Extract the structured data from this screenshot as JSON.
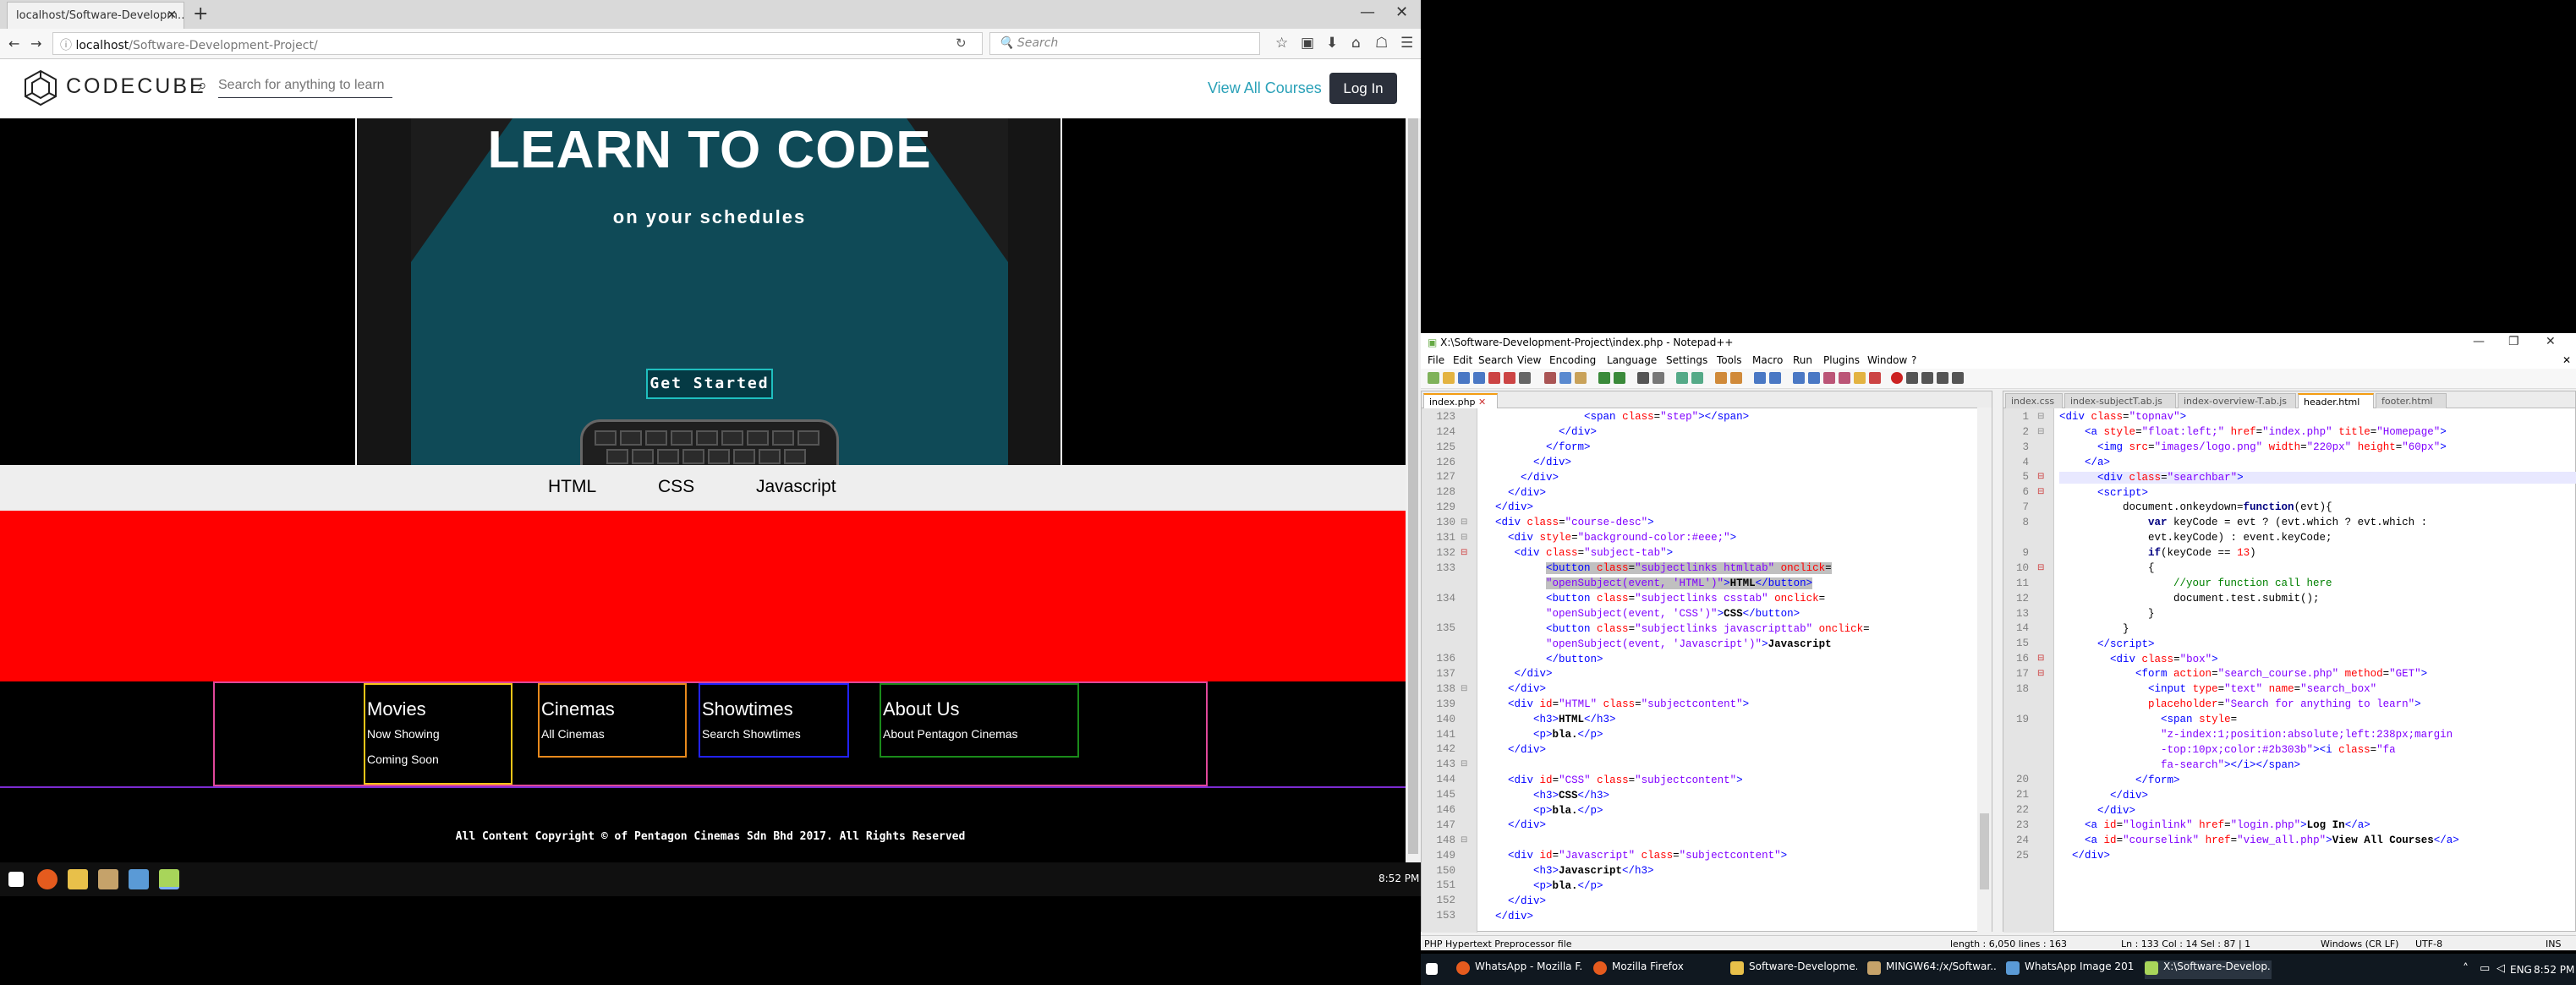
{
  "firefox": {
    "tab_title": "localhost/Software-Developm…",
    "url_host": "localhost",
    "url_path": "/Software-Development-Project/",
    "search_placeholder": "Search"
  },
  "site": {
    "logo_text": "CODECUBE",
    "search_placeholder": "Search for anything to learn",
    "view_all_courses": "View All Courses",
    "log_in": "Log In",
    "hero_title": "LEARN TO CODE",
    "hero_subtitle": "on your schedules",
    "get_started": "Get Started",
    "subjects": [
      "HTML",
      "CSS",
      "Javascript"
    ],
    "footer": [
      {
        "heading": "Movies",
        "items": [
          "Now Showing",
          "Coming Soon"
        ],
        "color": "#f5c518"
      },
      {
        "heading": "Cinemas",
        "items": [
          "All Cinemas"
        ],
        "color": "#e8891c"
      },
      {
        "heading": "Showtimes",
        "items": [
          "Search Showtimes"
        ],
        "color": "#2222ff"
      },
      {
        "heading": "About Us",
        "items": [
          "About Pentagon Cinemas"
        ],
        "color": "#1a8a1a"
      }
    ],
    "copyright": "All Content Copyright © of Pentagon Cinemas Sdn Bhd 2017. All Rights Reserved"
  },
  "left_clock": "8:52 PM",
  "npp": {
    "title": "X:\\Software-Development-Project\\index.php - Notepad++",
    "menu": [
      "File",
      "Edit",
      "Search",
      "View",
      "Encoding",
      "Language",
      "Settings",
      "Tools",
      "Macro",
      "Run",
      "Plugins",
      "Window",
      "?"
    ],
    "left_tabs": [
      "index.php"
    ],
    "right_tabs": [
      "index.css",
      "index-subjectT.ab.js",
      "index-overview-T.ab.js",
      "header.html",
      "footer.html"
    ],
    "status": {
      "type": "PHP Hypertext Preprocessor file",
      "length": "length : 6,050    lines : 163",
      "pos": "Ln : 133    Col : 14    Sel : 87 | 1",
      "eol": "Windows (CR LF)",
      "enc": "UTF-8",
      "ins": "INS"
    }
  },
  "taskbar_right": {
    "items": [
      "WhatsApp - Mozilla F...",
      "Mozilla Firefox",
      "Software-Developme...",
      "MINGW64:/x/Softwar...",
      "WhatsApp Image 201...",
      "X:\\Software-Develop..."
    ],
    "lang": "ENG",
    "clock": "8:52 PM"
  },
  "colors": {
    "brand": "#2b303b",
    "accent": "#2aa1b8",
    "hero": "#0f4a57"
  }
}
